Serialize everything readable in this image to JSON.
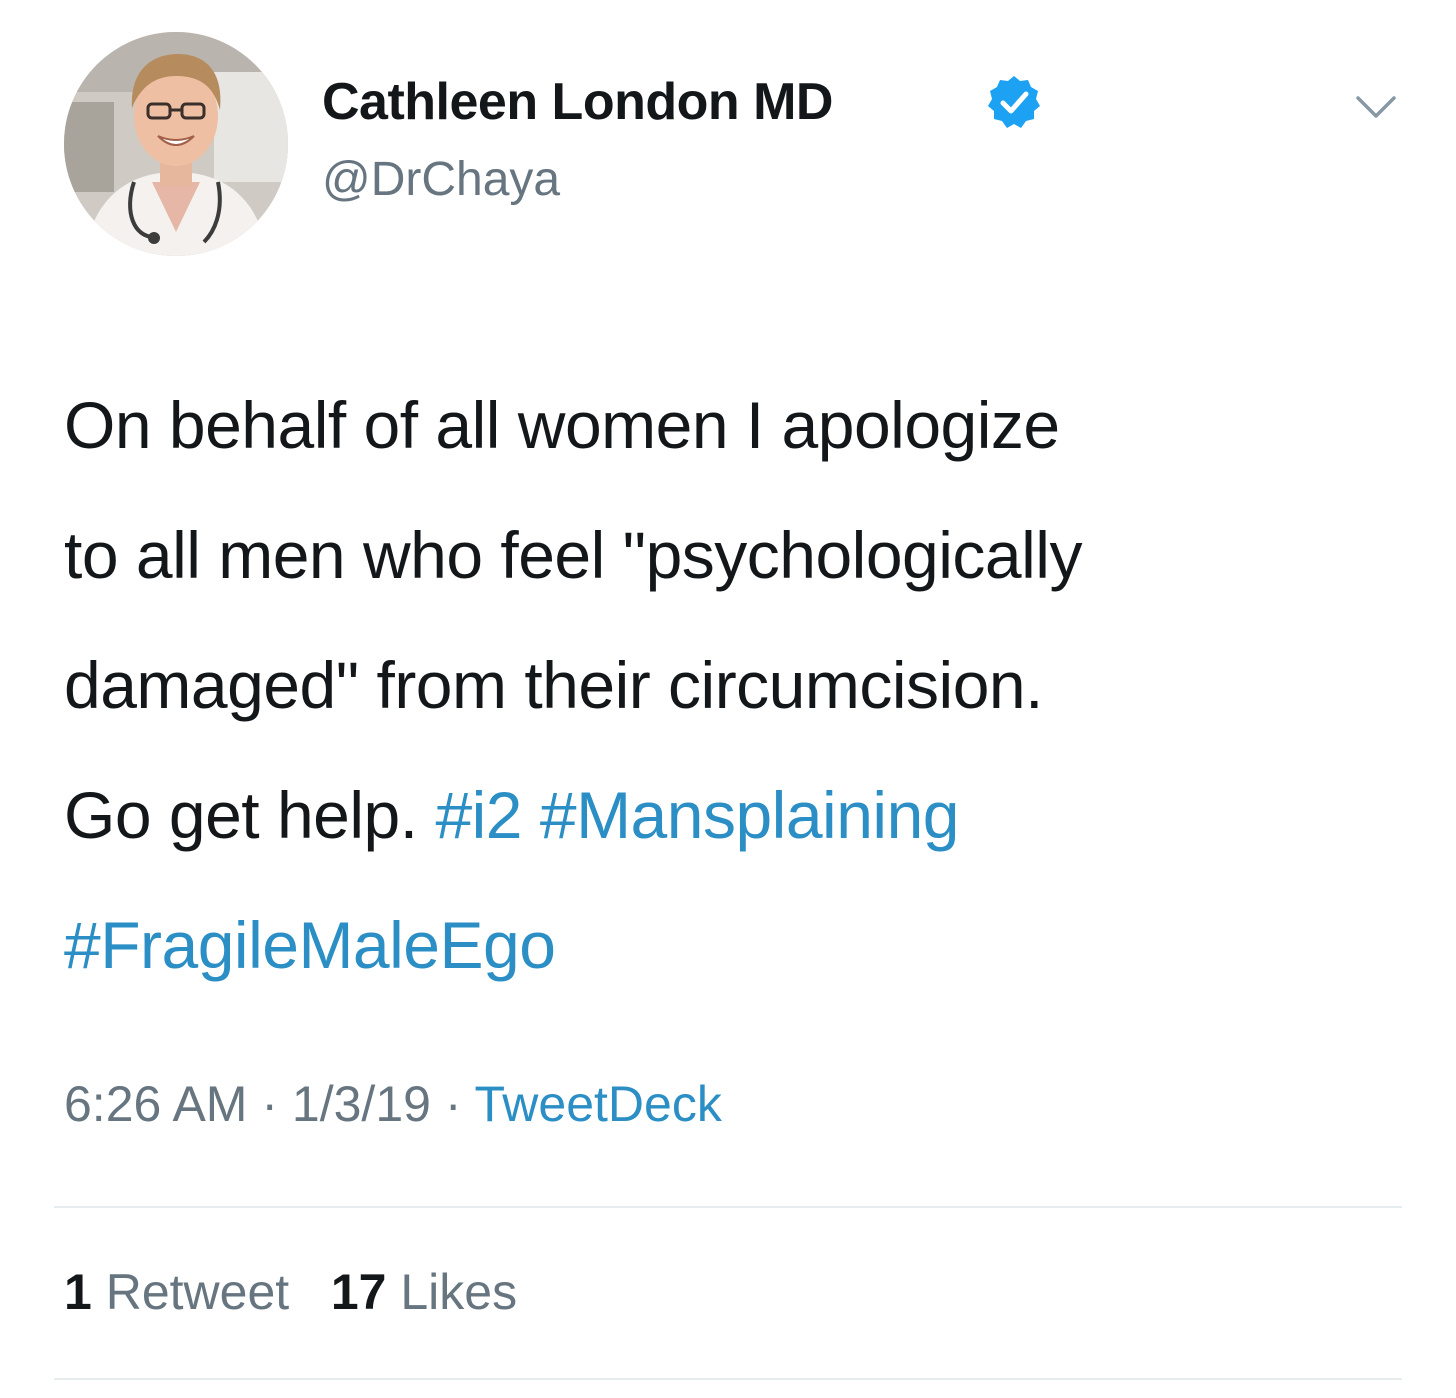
{
  "user": {
    "display_name": "Cathleen London MD",
    "handle": "@DrChaya",
    "verified": true
  },
  "tweet": {
    "lines": [
      "On behalf of all women I apologize",
      "to all men who feel \"psychologically",
      "damaged\" from their circumcision.",
      "Go get help."
    ],
    "hashtags": [
      "#i2",
      "#Mansplaining",
      "#FragileMaleEgo"
    ]
  },
  "meta": {
    "time": "6:26 AM",
    "separator": "·",
    "date": "1/3/19",
    "source": "TweetDeck"
  },
  "stats": {
    "retweets_count": "1",
    "retweets_label": "Retweet",
    "likes_count": "17",
    "likes_label": "Likes"
  },
  "colors": {
    "link": "#2b8ec4",
    "secondary": "#66757f",
    "verified": "#1da1f2"
  },
  "icons": [
    "verified-icon",
    "chevron-down-icon"
  ]
}
